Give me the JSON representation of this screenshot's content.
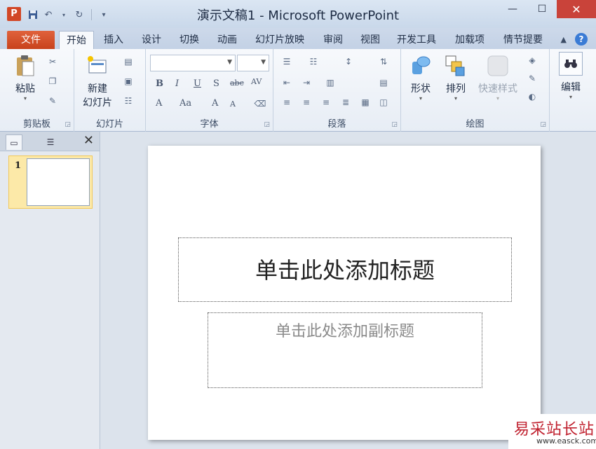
{
  "window": {
    "app_icon": "P",
    "title": "演示文稿1 - Microsoft PowerPoint"
  },
  "qat": {
    "save": "save-icon",
    "undo": "undo-icon",
    "redo": "redo-icon",
    "customize": "customize-icon"
  },
  "tabs": [
    {
      "label": "文件"
    },
    {
      "label": "开始"
    },
    {
      "label": "插入"
    },
    {
      "label": "设计"
    },
    {
      "label": "切换"
    },
    {
      "label": "动画"
    },
    {
      "label": "幻灯片放映"
    },
    {
      "label": "审阅"
    },
    {
      "label": "视图"
    },
    {
      "label": "开发工具"
    },
    {
      "label": "加载项"
    },
    {
      "label": "情节提要"
    }
  ],
  "ribbon": {
    "clipboard": {
      "paste": "粘贴",
      "label": "剪贴板"
    },
    "slides": {
      "new_line1": "新建",
      "new_line2": "幻灯片",
      "label": "幻灯片"
    },
    "font": {
      "bold": "B",
      "italic": "I",
      "underline": "U",
      "shadow": "S",
      "strike": "abc",
      "spacing": "AV",
      "case": "Aa",
      "grow": "A",
      "shrink": "A",
      "color": "A",
      "label": "字体"
    },
    "paragraph": {
      "label": "段落"
    },
    "drawing": {
      "shapes": "形状",
      "arrange": "排列",
      "styles": "快速样式",
      "label": "绘图"
    },
    "editing": {
      "edit": "编辑"
    }
  },
  "pane": {
    "slide_number": "1"
  },
  "slide": {
    "title_placeholder": "单击此处添加标题",
    "subtitle_placeholder": "单击此处添加副标题"
  },
  "watermark": {
    "line1": "易采站长站",
    "line2": "www.easck.com"
  }
}
